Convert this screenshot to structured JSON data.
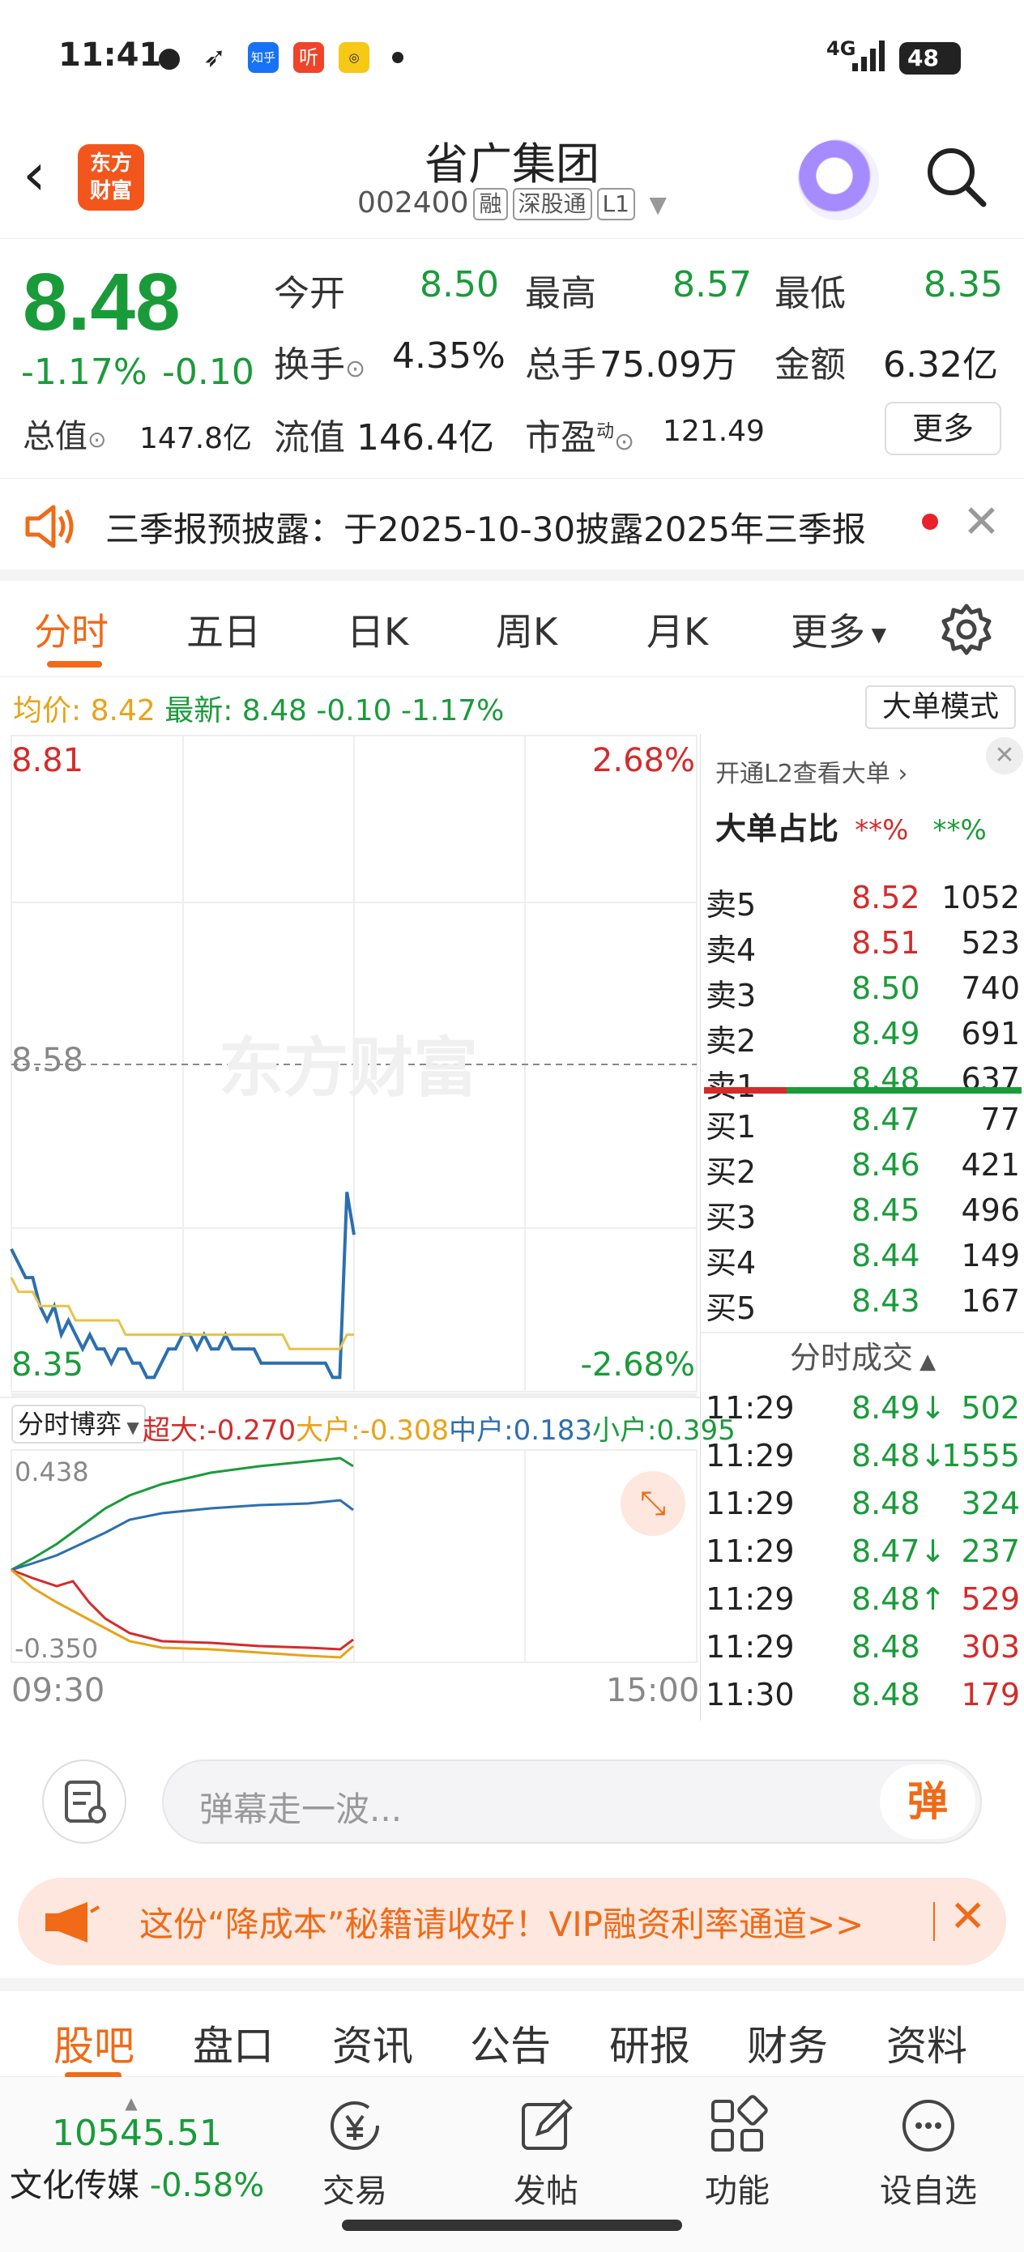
{
  "status_bar": {
    "time": "11:41",
    "app_icons": [
      "wechat-icon",
      "feishu-icon",
      "zhihu-icon",
      "ting-icon",
      "game-icon"
    ],
    "zhihu_label": "知乎",
    "ting_label": "听",
    "network": "4G",
    "battery": "48"
  },
  "header": {
    "logo_text_1": "东方",
    "logo_text_2": "财富",
    "title": "省广集团",
    "code": "002400",
    "tags": [
      "融",
      "深股通",
      "L1"
    ]
  },
  "quote": {
    "price": "8.48",
    "change_pct": "-1.17%",
    "change": "-0.10",
    "open_label": "今开",
    "open": "8.50",
    "high_label": "最高",
    "high": "8.57",
    "low_label": "最低",
    "low": "8.35",
    "turnover_label": "换手",
    "turnover": "4.35%",
    "volume_label": "总手",
    "volume": "75.09万",
    "amount_label": "金额",
    "amount": "6.32亿",
    "mktcap_label": "总值",
    "mktcap": "147.8亿",
    "float_label": "流值",
    "float_cap": "146.4亿",
    "pe_label": "市盈",
    "pe_sup": "动",
    "pe": "121.49",
    "more_label": "更多"
  },
  "notice": {
    "text": "三季报预披露：于2025-10-30披露2025年三季报"
  },
  "chart_tabs": {
    "items": [
      "分时",
      "五日",
      "日K",
      "周K",
      "月K",
      "更多"
    ],
    "active": 0
  },
  "avg_line": {
    "avg_label": "均价:",
    "avg_value": "8.42",
    "latest_label": "最新:",
    "latest_value": "8.48",
    "change": "-0.10",
    "change_pct": "-1.17%",
    "mode_button": "大单模式"
  },
  "chart": {
    "price_max": "8.81",
    "pct_max": "2.68%",
    "price_prev": "8.58",
    "price_min": "8.35",
    "pct_min": "-2.68%",
    "watermark": "东方财富",
    "flow_selector": "分时博弈",
    "flow_items": [
      {
        "label": "超大:",
        "value": "-0.270",
        "color": "#d52b2b"
      },
      {
        "label": "大户:",
        "value": "-0.308",
        "color": "#e8a317"
      },
      {
        "label": "中户:",
        "value": "0.183",
        "color": "#2c6fb0"
      },
      {
        "label": "小户:",
        "value": "0.395",
        "color": "#1a9b3a"
      }
    ],
    "flow_max": "0.438",
    "flow_min": "-0.350",
    "time_start": "09:30",
    "time_end": "15:00"
  },
  "chart_data": {
    "type": "line",
    "ylim": [
      8.35,
      8.81
    ],
    "series": [
      {
        "values": [
          8.45,
          8.44,
          8.43,
          8.43,
          8.41,
          8.4,
          8.41,
          8.39,
          8.4,
          8.39,
          8.38,
          8.39,
          8.38,
          8.38,
          8.37,
          8.38,
          8.38,
          8.37,
          8.37,
          8.36,
          8.36,
          8.37,
          8.38,
          8.38,
          8.39,
          8.39,
          8.38,
          8.39,
          8.38,
          8.38,
          8.39,
          8.38,
          8.38,
          8.38,
          8.38,
          8.37,
          8.37,
          8.37,
          8.37,
          8.37,
          8.37,
          8.37,
          8.37,
          8.37,
          8.37,
          8.36,
          8.36,
          8.49,
          8.46
        ]
      },
      {
        "values": [
          8.43,
          8.42,
          8.42,
          8.42,
          8.41,
          8.41,
          8.41,
          8.41,
          8.41,
          8.4,
          8.4,
          8.4,
          8.4,
          8.4,
          8.4,
          8.4,
          8.39,
          8.39,
          8.39,
          8.39,
          8.39,
          8.39,
          8.39,
          8.39,
          8.39,
          8.39,
          8.39,
          8.39,
          8.39,
          8.39,
          8.39,
          8.39,
          8.39,
          8.39,
          8.39,
          8.39,
          8.39,
          8.39,
          8.39,
          8.38,
          8.38,
          8.38,
          8.38,
          8.38,
          8.38,
          8.38,
          8.38,
          8.39,
          8.39
        ]
      }
    ]
  },
  "orderbook": {
    "header": "开通L2查看大单",
    "ratio_label": "大单占比",
    "ratio_red": "**%",
    "ratio_green": "**%",
    "asks": [
      {
        "label": "卖5",
        "price": "8.52",
        "vol": "1052",
        "color": "#d52b2b"
      },
      {
        "label": "卖4",
        "price": "8.51",
        "vol": "523",
        "color": "#d52b2b"
      },
      {
        "label": "卖3",
        "price": "8.50",
        "vol": "740",
        "color": "#1a9b3a"
      },
      {
        "label": "卖2",
        "price": "8.49",
        "vol": "691",
        "color": "#1a9b3a"
      },
      {
        "label": "卖1",
        "price": "8.48",
        "vol": "637",
        "color": "#1a9b3a"
      }
    ],
    "bids": [
      {
        "label": "买1",
        "price": "8.47",
        "vol": "77",
        "color": "#1a9b3a"
      },
      {
        "label": "买2",
        "price": "8.46",
        "vol": "421",
        "color": "#1a9b3a"
      },
      {
        "label": "买3",
        "price": "8.45",
        "vol": "496",
        "color": "#1a9b3a"
      },
      {
        "label": "买4",
        "price": "8.44",
        "vol": "149",
        "color": "#1a9b3a"
      },
      {
        "label": "买5",
        "price": "8.43",
        "vol": "167",
        "color": "#1a9b3a"
      }
    ],
    "ticks_header": "分时成交",
    "ticks": [
      {
        "time": "11:29",
        "price": "8.49",
        "arrow": "↓",
        "vol": "502",
        "pcolor": "#1a9b3a",
        "vcolor": "#1a9b3a"
      },
      {
        "time": "11:29",
        "price": "8.48",
        "arrow": "↓",
        "vol": "1555",
        "pcolor": "#1a9b3a",
        "vcolor": "#1a9b3a"
      },
      {
        "time": "11:29",
        "price": "8.48",
        "arrow": "",
        "vol": "324",
        "pcolor": "#1a9b3a",
        "vcolor": "#1a9b3a"
      },
      {
        "time": "11:29",
        "price": "8.47",
        "arrow": "↓",
        "vol": "237",
        "pcolor": "#1a9b3a",
        "vcolor": "#1a9b3a"
      },
      {
        "time": "11:29",
        "price": "8.48",
        "arrow": "↑",
        "vol": "529",
        "pcolor": "#1a9b3a",
        "vcolor": "#d52b2b"
      },
      {
        "time": "11:29",
        "price": "8.48",
        "arrow": "",
        "vol": "303",
        "pcolor": "#1a9b3a",
        "vcolor": "#d52b2b"
      },
      {
        "time": "11:30",
        "price": "8.48",
        "arrow": "",
        "vol": "179",
        "pcolor": "#1a9b3a",
        "vcolor": "#d52b2b"
      }
    ]
  },
  "chat": {
    "placeholder": "弹幕走一波...",
    "send_label": "弹"
  },
  "promo": {
    "text": "这份“降成本”秘籍请收好！VIP融资利率通道>>"
  },
  "bottom_tabs": {
    "items": [
      "股吧",
      "盘口",
      "资讯",
      "公告",
      "研报",
      "财务",
      "资料"
    ],
    "active": 0
  },
  "bottom_nav": {
    "index_value": "10545.51",
    "index_name": "文化传媒",
    "index_change": "-0.58%",
    "items": [
      "交易",
      "发帖",
      "功能",
      "设自选"
    ]
  }
}
